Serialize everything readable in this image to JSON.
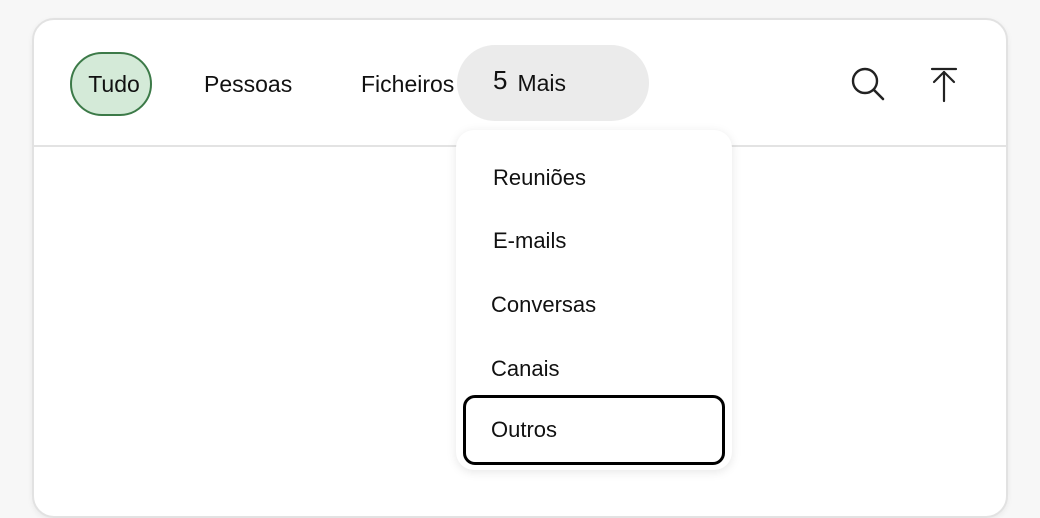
{
  "tabs": {
    "all": "Tudo",
    "people": "Pessoas",
    "files": "Ficheiros",
    "more_count": "5",
    "more_label": "Mais"
  },
  "icons": {
    "search": "search-icon",
    "scroll_top": "scroll-to-top-icon"
  },
  "more_menu": {
    "items": [
      "Reuniões",
      "E-mails",
      "Conversas",
      "Canais",
      "Outros"
    ],
    "focused_item": "Outros"
  },
  "colors": {
    "selected_tab_bg": "#d4ead8",
    "selected_tab_border": "#3c7a48",
    "more_tab_bg": "#ebebeb",
    "focus_ring": "#000000"
  }
}
